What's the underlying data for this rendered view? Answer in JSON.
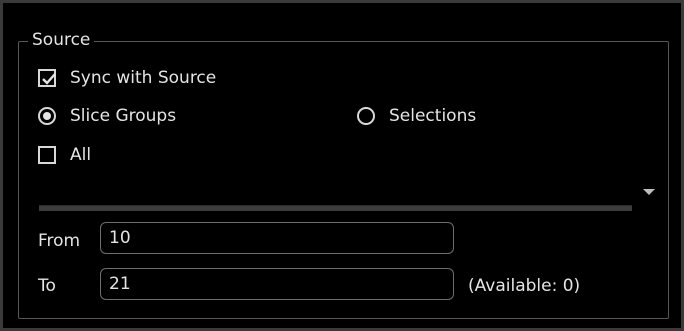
{
  "source": {
    "title": "Source",
    "sync_with_source": {
      "label": "Sync with Source",
      "checked": true
    },
    "slice_groups": {
      "label": "Slice Groups",
      "selected": true
    },
    "selections": {
      "label": "Selections",
      "selected": false
    },
    "all": {
      "label": "All",
      "checked": false
    },
    "from": {
      "label": "From",
      "value": "10"
    },
    "to": {
      "label": "To",
      "value": "21"
    },
    "available_text": "(Available: 0)"
  },
  "colors": {
    "background": "#000000",
    "text": "#e4e4e4",
    "border": "#575757",
    "field_border": "#6d6d6d"
  },
  "icons": {
    "check": "check-icon",
    "radio_selected": "radio-dot-icon",
    "dropdown": "chevron-down-icon"
  }
}
